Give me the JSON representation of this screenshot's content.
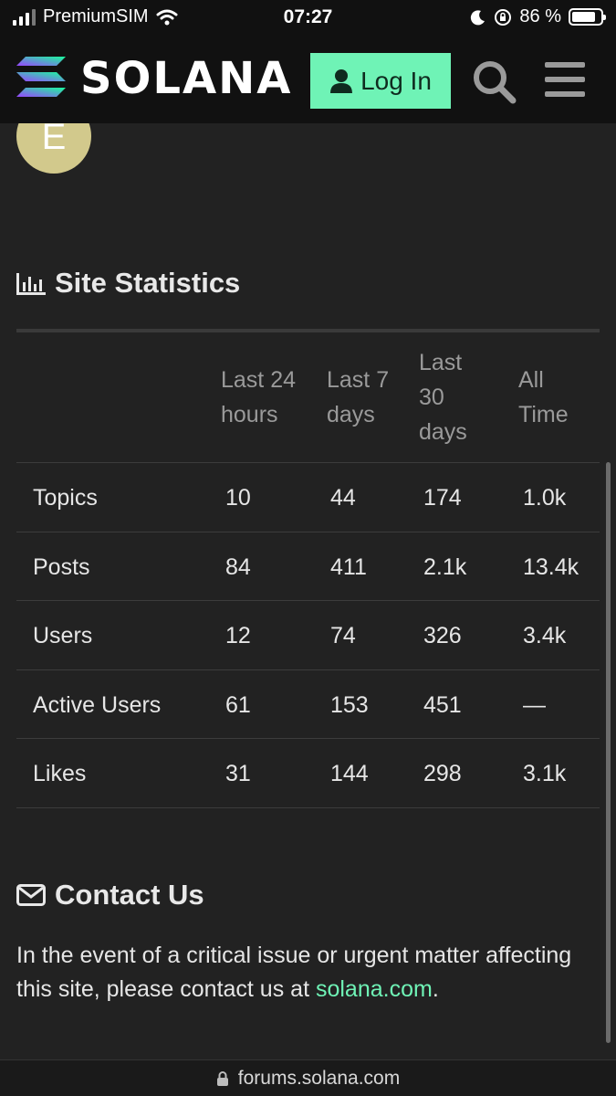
{
  "status_bar": {
    "carrier": "PremiumSIM",
    "time": "07:27",
    "battery": "86 %",
    "battery_level": 0.86
  },
  "header": {
    "brand": "SOLANA",
    "login_label": "Log In",
    "colors": {
      "accent": "#6ff3b6",
      "header_bg": "#111111"
    }
  },
  "avatar": {
    "letter": "E",
    "color": "#d2c98c"
  },
  "stats": {
    "title": "Site Statistics",
    "columns": [
      "Last 24 hours",
      "Last 7 days",
      "Last 30 days",
      "All Time"
    ],
    "column_lines": [
      [
        "Last 24",
        "hours"
      ],
      [
        "Last 7",
        "days"
      ],
      [
        "Last",
        "30",
        "days"
      ],
      [
        "All",
        "Time"
      ]
    ],
    "rows": [
      {
        "label": "Topics",
        "values": [
          "10",
          "44",
          "174",
          "1.0k"
        ]
      },
      {
        "label": "Posts",
        "values": [
          "84",
          "411",
          "2.1k",
          "13.4k"
        ]
      },
      {
        "label": "Users",
        "values": [
          "12",
          "74",
          "326",
          "3.4k"
        ]
      },
      {
        "label": "Active Users",
        "values": [
          "61",
          "153",
          "451",
          "—"
        ]
      },
      {
        "label": "Likes",
        "values": [
          "31",
          "144",
          "298",
          "3.1k"
        ]
      }
    ]
  },
  "contact": {
    "title": "Contact Us",
    "text": "In the event of a critical issue or urgent matter affecting this site, please contact us at",
    "link": "solana.com",
    "trailing": "."
  },
  "url_bar": {
    "url": "forums.solana.com"
  },
  "icons": {
    "signal": "signal-icon",
    "wifi": "wifi-icon",
    "moon": "moon-icon",
    "orientation_lock": "orientation-lock-icon",
    "battery": "battery-icon",
    "user": "user-icon",
    "search": "search-icon",
    "menu": "hamburger-menu-icon",
    "chart": "bar-chart-icon",
    "envelope": "envelope-icon",
    "lock": "lock-icon"
  }
}
